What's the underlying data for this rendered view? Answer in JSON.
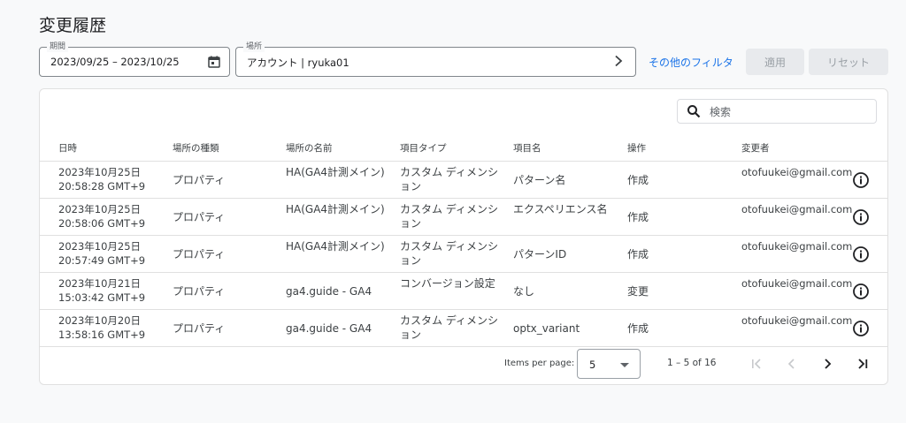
{
  "header": {
    "title": "変更履歴"
  },
  "filters": {
    "period": {
      "label": "期間",
      "value": "2023/09/25 – 2023/10/25",
      "icon": "calendar-icon"
    },
    "location": {
      "label": "場所",
      "value": "アカウント | ryuka01",
      "icon": "chevron-right-icon"
    },
    "other_filters_label": "その他のフィルタ",
    "apply_label": "適用",
    "reset_label": "リセット"
  },
  "search": {
    "placeholder": "検索",
    "value": ""
  },
  "table": {
    "columns": [
      "日時",
      "場所の種類",
      "場所の名前",
      "項目タイプ",
      "項目名",
      "操作",
      "変更者"
    ],
    "rows": [
      {
        "date1": "2023年10月25日",
        "date2": "20:58:28 GMT+9",
        "location_type": "プロパティ",
        "location_name": "HA(GA4計測メイン)",
        "item_type": "カスタム ディメンション",
        "item_name": "パターン名",
        "operation": "作成",
        "changed_by": "otofuukei@gmail.com"
      },
      {
        "date1": "2023年10月25日",
        "date2": "20:58:06 GMT+9",
        "location_type": "プロパティ",
        "location_name": "HA(GA4計測メイン)",
        "item_type": "カスタム ディメンション",
        "item_name": "エクスペリエンス名",
        "operation": "作成",
        "changed_by": "otofuukei@gmail.com"
      },
      {
        "date1": "2023年10月25日",
        "date2": "20:57:49 GMT+9",
        "location_type": "プロパティ",
        "location_name": "HA(GA4計測メイン)",
        "item_type": "カスタム ディメンション",
        "item_name": "パターンID",
        "operation": "作成",
        "changed_by": "otofuukei@gmail.com"
      },
      {
        "date1": "2023年10月21日",
        "date2": "15:03:42 GMT+9",
        "location_type": "プロパティ",
        "location_name": "ga4.guide - GA4",
        "item_type": "コンバージョン設定",
        "item_name": "なし",
        "operation": "変更",
        "changed_by": "otofuukei@gmail.com"
      },
      {
        "date1": "2023年10月20日",
        "date2": "13:58:16 GMT+9",
        "location_type": "プロパティ",
        "location_name": "ga4.guide - GA4",
        "item_type": "カスタム ディメンション",
        "item_name": "optx_variant",
        "operation": "作成",
        "changed_by": "otofuukei@gmail.com"
      }
    ]
  },
  "paginator": {
    "items_per_page_label": "Items per page:",
    "items_per_page": "5",
    "range_label": "1 – 5 of 16"
  },
  "colors": {
    "accent": "#1a73e8",
    "disabled_bg": "#e8eaed",
    "disabled_text": "#9aa0a6",
    "border": "#e0e0e0"
  }
}
